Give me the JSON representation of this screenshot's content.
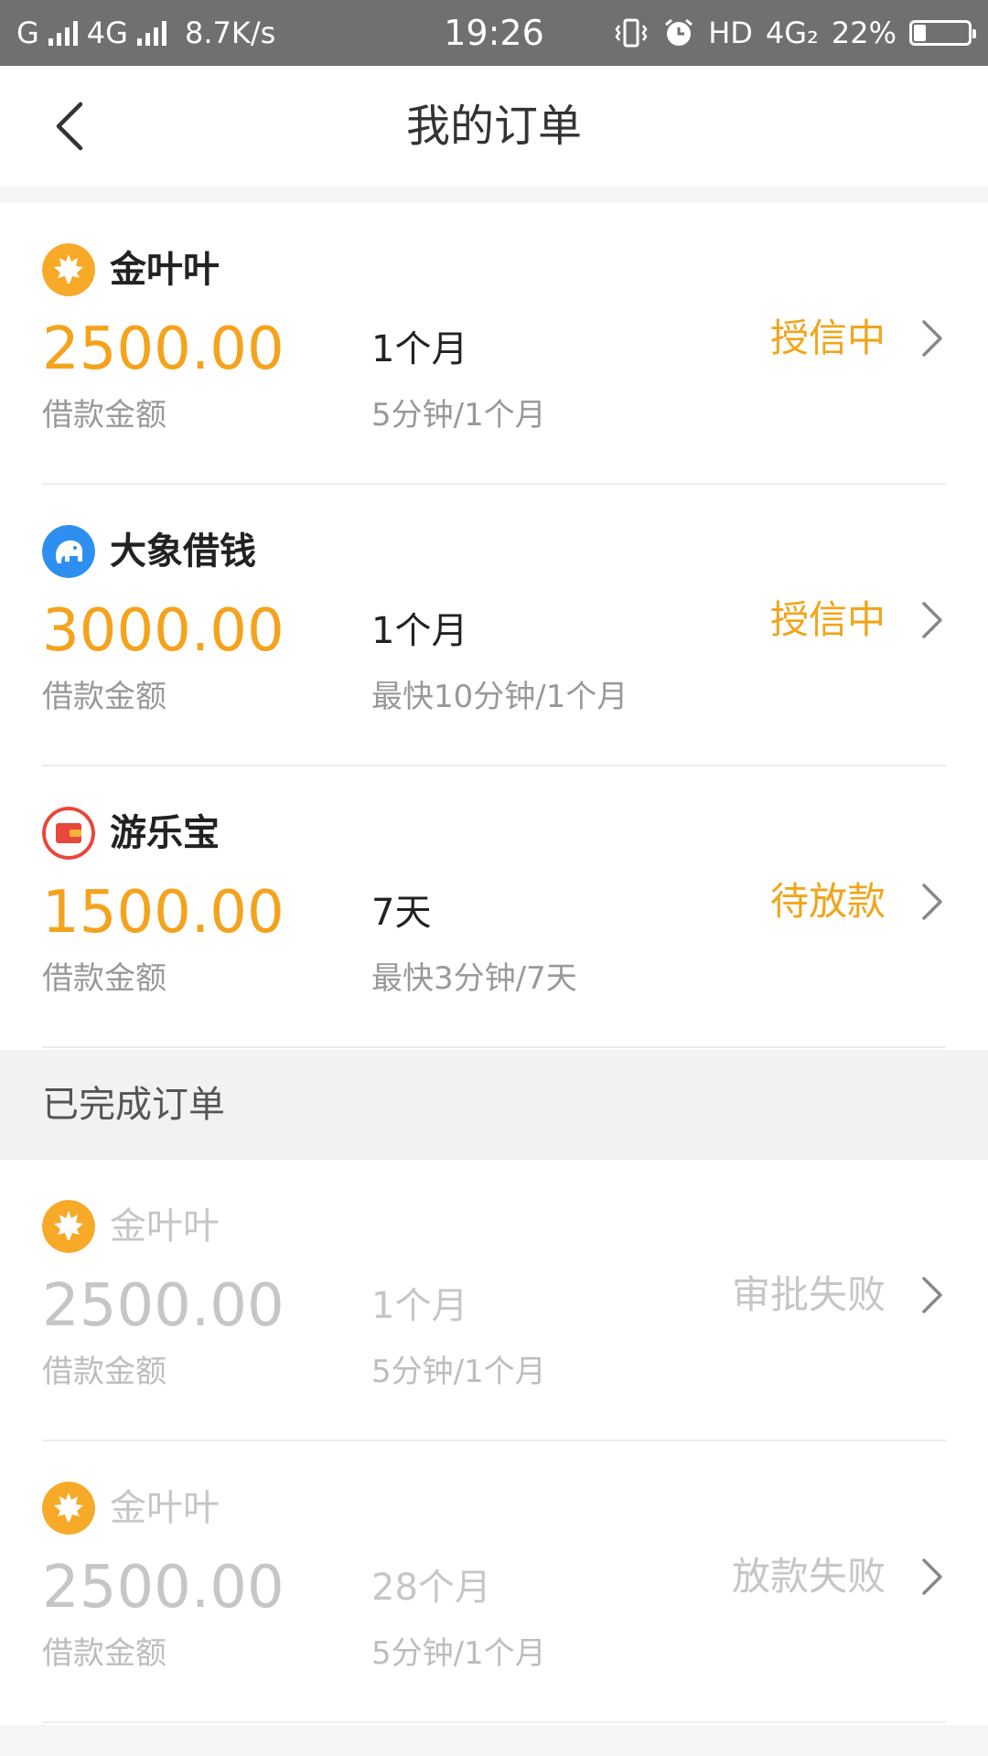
{
  "status_bar": {
    "carrier1": "G",
    "carrier2": "4G",
    "speed": "8.7K/s",
    "time": "19:26",
    "hd": "HD",
    "network": "4G₂",
    "battery": "22%",
    "battery_level": 0.22
  },
  "header": {
    "title": "我的订单"
  },
  "active_orders": [
    {
      "name": "金叶叶",
      "amount": "2500.00",
      "amount_label": "借款金额",
      "term": "1个月",
      "term_sub": "5分钟/1个月",
      "status": "授信中",
      "icon": "maple-leaf-icon"
    },
    {
      "name": "大象借钱",
      "amount": "3000.00",
      "amount_label": "借款金额",
      "term": "1个月",
      "term_sub": "最快10分钟/1个月",
      "status": "授信中",
      "icon": "elephant-icon"
    },
    {
      "name": "游乐宝",
      "amount": "1500.00",
      "amount_label": "借款金额",
      "term": "7天",
      "term_sub": "最快3分钟/7天",
      "status": "待放款",
      "icon": "wallet-icon"
    }
  ],
  "completed": {
    "title": "已完成订单",
    "orders": [
      {
        "name": "金叶叶",
        "amount": "2500.00",
        "amount_label": "借款金额",
        "term": "1个月",
        "term_sub": "5分钟/1个月",
        "status": "审批失败",
        "icon": "maple-leaf-icon"
      },
      {
        "name": "金叶叶",
        "amount": "2500.00",
        "amount_label": "借款金额",
        "term": "28个月",
        "term_sub": "5分钟/1个月",
        "status": "放款失败",
        "icon": "maple-leaf-icon"
      }
    ]
  },
  "colors": {
    "accent": "#f5a21c",
    "status": "#f0a51b",
    "muted": "#c6c6c6"
  }
}
